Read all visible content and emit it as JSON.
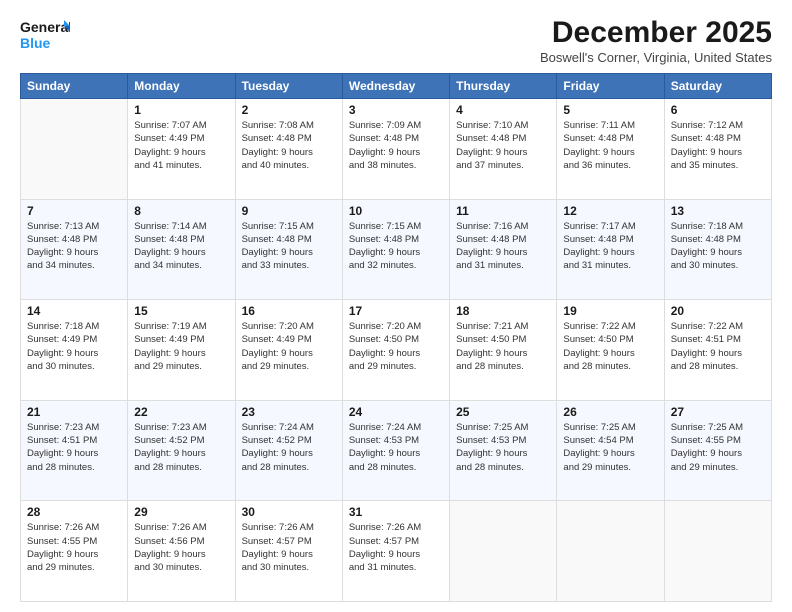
{
  "header": {
    "logo_line1": "General",
    "logo_line2": "Blue",
    "month": "December 2025",
    "location": "Boswell's Corner, Virginia, United States"
  },
  "days_of_week": [
    "Sunday",
    "Monday",
    "Tuesday",
    "Wednesday",
    "Thursday",
    "Friday",
    "Saturday"
  ],
  "weeks": [
    [
      {
        "day": "",
        "info": ""
      },
      {
        "day": "1",
        "info": "Sunrise: 7:07 AM\nSunset: 4:49 PM\nDaylight: 9 hours\nand 41 minutes."
      },
      {
        "day": "2",
        "info": "Sunrise: 7:08 AM\nSunset: 4:48 PM\nDaylight: 9 hours\nand 40 minutes."
      },
      {
        "day": "3",
        "info": "Sunrise: 7:09 AM\nSunset: 4:48 PM\nDaylight: 9 hours\nand 38 minutes."
      },
      {
        "day": "4",
        "info": "Sunrise: 7:10 AM\nSunset: 4:48 PM\nDaylight: 9 hours\nand 37 minutes."
      },
      {
        "day": "5",
        "info": "Sunrise: 7:11 AM\nSunset: 4:48 PM\nDaylight: 9 hours\nand 36 minutes."
      },
      {
        "day": "6",
        "info": "Sunrise: 7:12 AM\nSunset: 4:48 PM\nDaylight: 9 hours\nand 35 minutes."
      }
    ],
    [
      {
        "day": "7",
        "info": "Sunrise: 7:13 AM\nSunset: 4:48 PM\nDaylight: 9 hours\nand 34 minutes."
      },
      {
        "day": "8",
        "info": "Sunrise: 7:14 AM\nSunset: 4:48 PM\nDaylight: 9 hours\nand 34 minutes."
      },
      {
        "day": "9",
        "info": "Sunrise: 7:15 AM\nSunset: 4:48 PM\nDaylight: 9 hours\nand 33 minutes."
      },
      {
        "day": "10",
        "info": "Sunrise: 7:15 AM\nSunset: 4:48 PM\nDaylight: 9 hours\nand 32 minutes."
      },
      {
        "day": "11",
        "info": "Sunrise: 7:16 AM\nSunset: 4:48 PM\nDaylight: 9 hours\nand 31 minutes."
      },
      {
        "day": "12",
        "info": "Sunrise: 7:17 AM\nSunset: 4:48 PM\nDaylight: 9 hours\nand 31 minutes."
      },
      {
        "day": "13",
        "info": "Sunrise: 7:18 AM\nSunset: 4:48 PM\nDaylight: 9 hours\nand 30 minutes."
      }
    ],
    [
      {
        "day": "14",
        "info": "Sunrise: 7:18 AM\nSunset: 4:49 PM\nDaylight: 9 hours\nand 30 minutes."
      },
      {
        "day": "15",
        "info": "Sunrise: 7:19 AM\nSunset: 4:49 PM\nDaylight: 9 hours\nand 29 minutes."
      },
      {
        "day": "16",
        "info": "Sunrise: 7:20 AM\nSunset: 4:49 PM\nDaylight: 9 hours\nand 29 minutes."
      },
      {
        "day": "17",
        "info": "Sunrise: 7:20 AM\nSunset: 4:50 PM\nDaylight: 9 hours\nand 29 minutes."
      },
      {
        "day": "18",
        "info": "Sunrise: 7:21 AM\nSunset: 4:50 PM\nDaylight: 9 hours\nand 28 minutes."
      },
      {
        "day": "19",
        "info": "Sunrise: 7:22 AM\nSunset: 4:50 PM\nDaylight: 9 hours\nand 28 minutes."
      },
      {
        "day": "20",
        "info": "Sunrise: 7:22 AM\nSunset: 4:51 PM\nDaylight: 9 hours\nand 28 minutes."
      }
    ],
    [
      {
        "day": "21",
        "info": "Sunrise: 7:23 AM\nSunset: 4:51 PM\nDaylight: 9 hours\nand 28 minutes."
      },
      {
        "day": "22",
        "info": "Sunrise: 7:23 AM\nSunset: 4:52 PM\nDaylight: 9 hours\nand 28 minutes."
      },
      {
        "day": "23",
        "info": "Sunrise: 7:24 AM\nSunset: 4:52 PM\nDaylight: 9 hours\nand 28 minutes."
      },
      {
        "day": "24",
        "info": "Sunrise: 7:24 AM\nSunset: 4:53 PM\nDaylight: 9 hours\nand 28 minutes."
      },
      {
        "day": "25",
        "info": "Sunrise: 7:25 AM\nSunset: 4:53 PM\nDaylight: 9 hours\nand 28 minutes."
      },
      {
        "day": "26",
        "info": "Sunrise: 7:25 AM\nSunset: 4:54 PM\nDaylight: 9 hours\nand 29 minutes."
      },
      {
        "day": "27",
        "info": "Sunrise: 7:25 AM\nSunset: 4:55 PM\nDaylight: 9 hours\nand 29 minutes."
      }
    ],
    [
      {
        "day": "28",
        "info": "Sunrise: 7:26 AM\nSunset: 4:55 PM\nDaylight: 9 hours\nand 29 minutes."
      },
      {
        "day": "29",
        "info": "Sunrise: 7:26 AM\nSunset: 4:56 PM\nDaylight: 9 hours\nand 30 minutes."
      },
      {
        "day": "30",
        "info": "Sunrise: 7:26 AM\nSunset: 4:57 PM\nDaylight: 9 hours\nand 30 minutes."
      },
      {
        "day": "31",
        "info": "Sunrise: 7:26 AM\nSunset: 4:57 PM\nDaylight: 9 hours\nand 31 minutes."
      },
      {
        "day": "",
        "info": ""
      },
      {
        "day": "",
        "info": ""
      },
      {
        "day": "",
        "info": ""
      }
    ]
  ]
}
